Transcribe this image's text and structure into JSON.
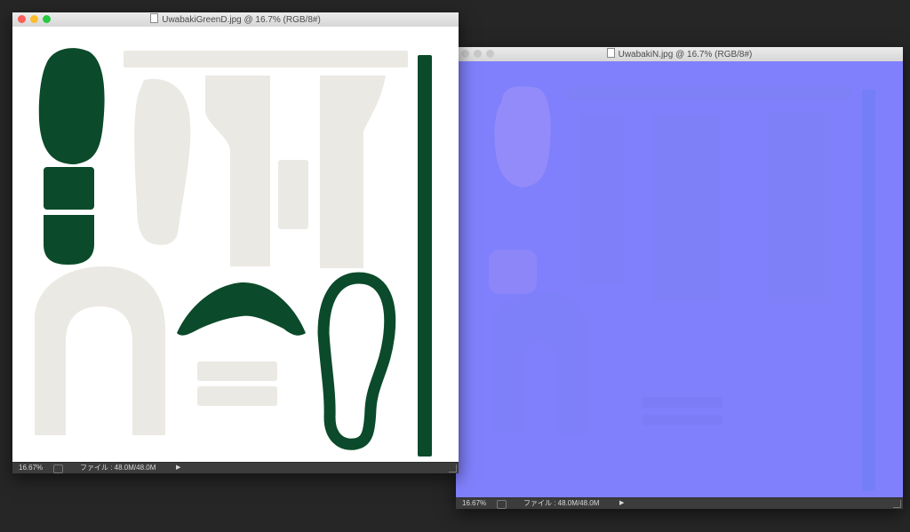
{
  "window_diffuse": {
    "title": "UwabakiGreenD.jpg @ 16.7% (RGB/8#)",
    "status": {
      "zoom": "16.67%",
      "doc_info": "ファイル : 48.0M/48.0M"
    }
  },
  "window_normal": {
    "title": "UwabakiN.jpg @ 16.7% (RGB/8#)",
    "status": {
      "zoom": "16.67%",
      "doc_info": "ファイル : 48.0M/48.0M"
    }
  },
  "colors": {
    "desktop_bg": "#262626",
    "diffuse_bg": "#ffffff",
    "sole_green": "#0b4a2a",
    "fabric_cream": "#ebe9e3",
    "normal_blue": "#8080fc",
    "close_red": "#fc5f57",
    "minimize_yellow": "#fdbc2e",
    "zoom_green": "#28c840"
  }
}
